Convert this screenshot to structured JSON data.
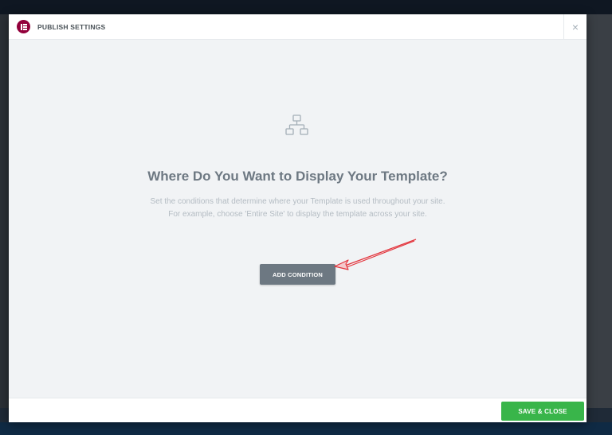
{
  "header": {
    "title": "PUBLISH SETTINGS",
    "close_symbol": "×",
    "logo_icon": "elementor-logo-icon"
  },
  "body": {
    "icon": "sitemap-icon",
    "title": "Where Do You Want to Display Your Template?",
    "description_line1": "Set the conditions that determine where your Template is used throughout your site.",
    "description_line2": "For example, choose 'Entire Site' to display the template across your site.",
    "add_condition_label": "ADD CONDITION"
  },
  "footer": {
    "save_close_label": "SAVE & CLOSE"
  },
  "colors": {
    "brand": "#92003b",
    "save": "#39b54a",
    "annotation_arrow": "#e3343c",
    "button_gray": "#6d7882"
  }
}
